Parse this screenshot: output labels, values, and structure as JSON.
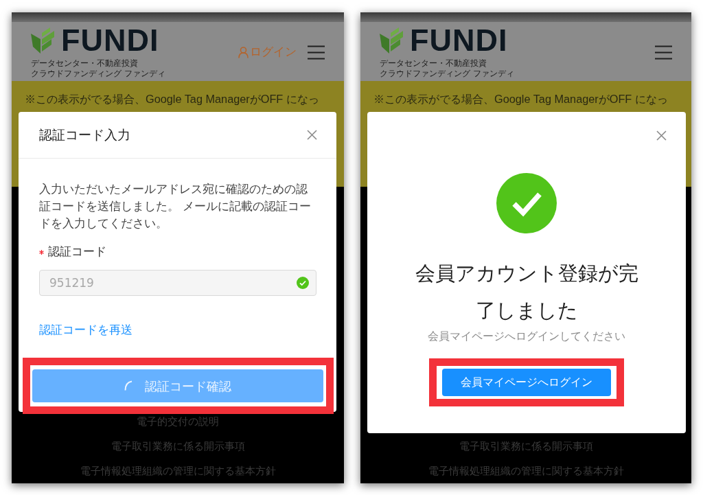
{
  "screens": [
    {
      "header": {
        "logo_text": "FUNDI",
        "tagline": [
          "データセンター・不動産投資",
          "クラウドファンディング ファンディ"
        ],
        "login_link": "ログイン"
      },
      "notice": "※この表示がでる場合、Google Tag ManagerがOFF になっ",
      "footer_links": [
        "電子的交付の説明",
        "電子取引業務に係る開示事項",
        "電子情報処理組織の管理に関する基本方針"
      ],
      "dialog": {
        "kind": "code_entry",
        "title": "認証コード入力",
        "message": "入力いただいたメールアドレス宛に確認のための認証コードを送信しました。 メールに記載の認証コードを入力してください。",
        "field": {
          "label": "認証コード",
          "required": true,
          "value": "951219",
          "valid": true
        },
        "resend_link": "認証コードを再送",
        "button": {
          "label": "認証コード確認",
          "loading": true,
          "highlighted": true
        }
      }
    },
    {
      "header": {
        "logo_text": "FUNDI",
        "tagline": [
          "データセンター・不動産投資",
          "クラウドファンディング ファンディ"
        ]
      },
      "notice": "※この表示がでる場合、Google Tag ManagerがOFF になっ",
      "footer_links": [
        "電子取引業務に係る開示事項",
        "電子情報処理組織の管理に関する基本方針"
      ],
      "dialog": {
        "kind": "success",
        "title": "会員アカウント登録が完了しました",
        "message": "会員マイページへログインしてください",
        "button": {
          "label": "会員マイページへログイン",
          "loading": false,
          "highlighted": true
        }
      }
    }
  ]
}
